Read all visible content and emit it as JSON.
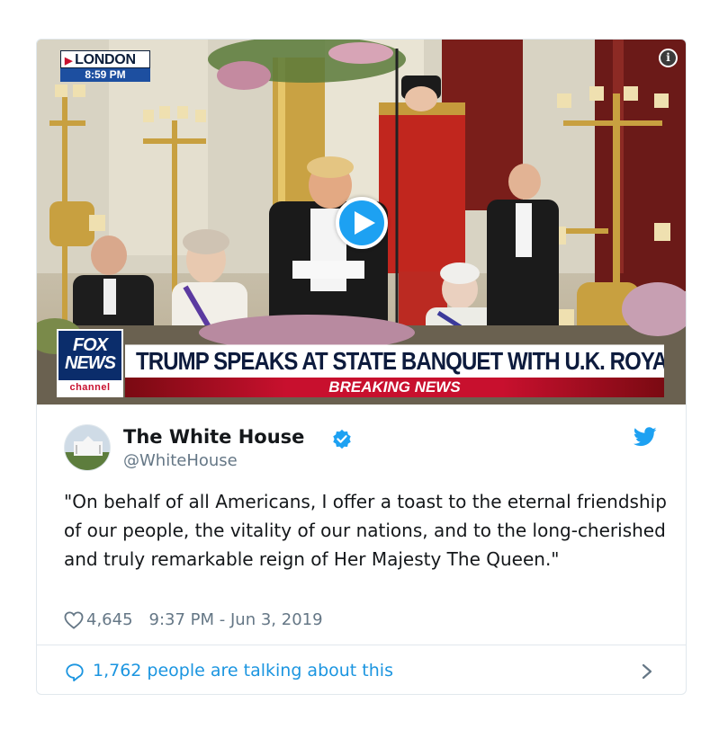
{
  "media": {
    "location": "LONDON",
    "time": "8:59 PM",
    "network_logo": {
      "line1": "FOX",
      "line2": "NEWS",
      "line3": "channel"
    },
    "headline": "TRUMP SPEAKS AT STATE BANQUET WITH U.K. ROYALS",
    "banner": "BREAKING NEWS"
  },
  "tweet": {
    "author_name": "The White House",
    "author_handle": "@WhiteHouse",
    "text": "\"On behalf of all Americans, I offer a toast to the eternal friendship of our people, the vitality of our nations, and to the long-cherished and truly remarkable reign of Her Majesty The Queen.\"",
    "likes": "4,645",
    "timestamp": "9:37 PM - Jun 3, 2019",
    "talking_about": "1,762 people are talking about this"
  },
  "icons": {
    "info": "info-icon",
    "play": "play-icon",
    "verified": "verified-badge-icon",
    "bird": "twitter-bird-icon",
    "heart": "heart-icon",
    "comment": "speech-bubble-icon",
    "chevron": "chevron-right-icon"
  },
  "colors": {
    "twitter_blue": "#1da1f2",
    "link_blue": "#1b95e0",
    "secondary_text": "#657786",
    "border": "#e1e8ed",
    "breaking_red": "#c8102e",
    "fox_navy": "#0b2d6b"
  }
}
